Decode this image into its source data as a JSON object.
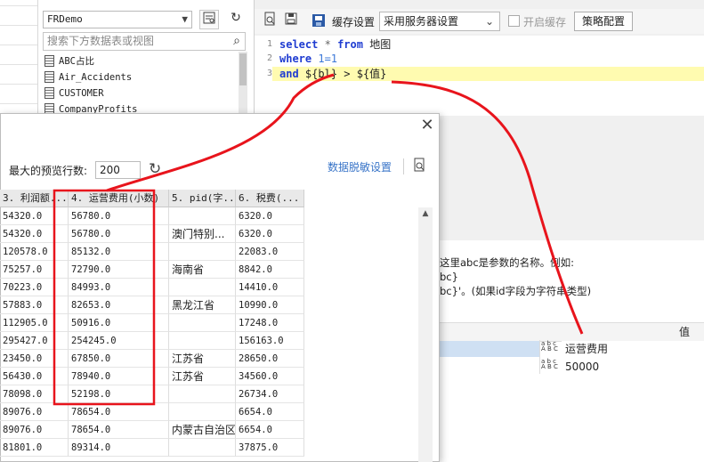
{
  "datasource": {
    "connection": "FRDemo",
    "search_placeholder": "搜索下方数据表或视图",
    "tables": [
      "ABC占比",
      "Air_Accidents",
      "CUSTOMER",
      "CompanyProfits"
    ]
  },
  "editor_toolbar": {
    "cache_label": "缓存设置",
    "cache_mode": "采用服务器设置",
    "enable_cache_label": "开启缓存",
    "strategy_button": "策略配置"
  },
  "sql": {
    "line_numbers": [
      "1",
      "2",
      "3"
    ],
    "line1": {
      "kw1": "select",
      "op": "*",
      "kw2": "from",
      "rest": "地图"
    },
    "line2": {
      "kw": "where",
      "expr": "1=1"
    },
    "line3": {
      "kw": "and",
      "rest": "${bl} > ${值}"
    }
  },
  "hint": {
    "line1": "这里abc是参数的名称。例如:",
    "line2": "bc}",
    "line3": "bc}'。(如果id字段为字符串类型)"
  },
  "parameters": {
    "value_column_label": "值",
    "rows": [
      {
        "value": "运营费用",
        "type_icon": "abc-icon"
      },
      {
        "value": "50000",
        "type_icon": "abc-icon"
      }
    ]
  },
  "preview_dialog": {
    "max_rows_label": "最大的预览行数:",
    "max_rows_value": "200",
    "mask_settings_link": "数据脱敏设置",
    "columns": [
      "3. 利润额...",
      "4. 运营费用(小数)",
      "5. pid(字...",
      "6. 税费(..."
    ],
    "rows": [
      [
        "54320.0",
        "56780.0",
        "",
        "6320.0"
      ],
      [
        "54320.0",
        "56780.0",
        "澳门特别...",
        "6320.0"
      ],
      [
        "120578.0",
        "85132.0",
        "",
        "22083.0"
      ],
      [
        "75257.0",
        "72790.0",
        "海南省",
        "8842.0"
      ],
      [
        "70223.0",
        "84993.0",
        "",
        "14410.0"
      ],
      [
        "57883.0",
        "82653.0",
        "黑龙江省",
        "10990.0"
      ],
      [
        "112905.0",
        "50916.0",
        "",
        "17248.0"
      ],
      [
        "295427.0",
        "254245.0",
        "",
        "156163.0"
      ],
      [
        "23450.0",
        "67850.0",
        "江苏省",
        "28650.0"
      ],
      [
        "56430.0",
        "78940.0",
        "江苏省",
        "34560.0"
      ],
      [
        "78098.0",
        "52198.0",
        "",
        "26734.0"
      ],
      [
        "89076.0",
        "78654.0",
        "",
        "6654.0"
      ],
      [
        "89076.0",
        "78654.0",
        "内蒙古自治区",
        "6654.0"
      ],
      [
        "81801.0",
        "89314.0",
        "",
        "37875.0"
      ]
    ]
  },
  "colors": {
    "annotation_red": "#e8141c",
    "keyword_blue": "#1f3cd1",
    "highlight_line": "#fffbb0",
    "link_blue": "#3874c8",
    "selection_blue": "#cfe0f3"
  }
}
